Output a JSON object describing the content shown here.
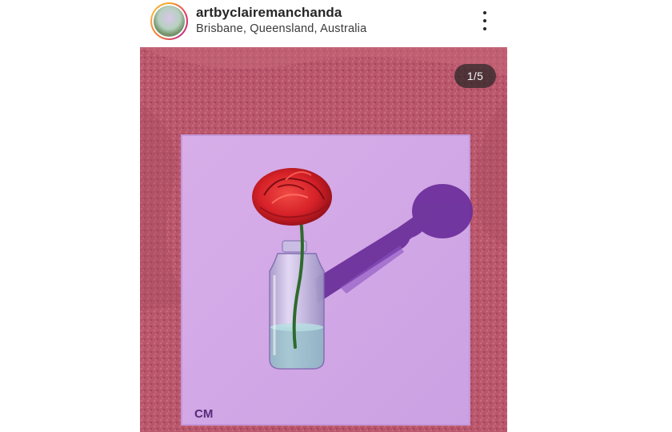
{
  "post": {
    "username": "artbyclairemanchanda",
    "location": "Brisbane, Queensland, Australia",
    "media_counter": "1/5",
    "more_icon": "more-vertical-icon"
  },
  "artwork": {
    "signature": "CM"
  },
  "colors": {
    "carpet": "#b9566b",
    "canvas": "#d4a9e8",
    "shadow": "#6a2d9a",
    "rose": "#d9242a",
    "stem": "#2f6a2c"
  }
}
